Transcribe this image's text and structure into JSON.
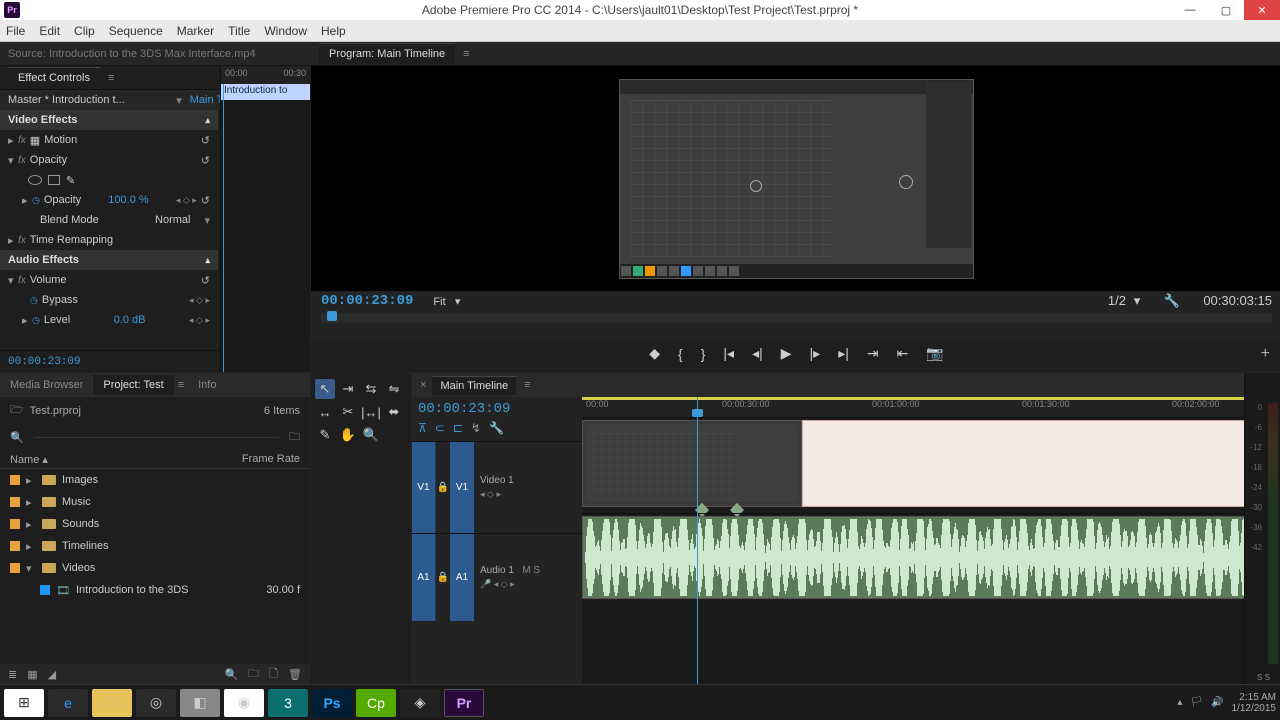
{
  "titlebar": {
    "app_icon_text": "Pr",
    "title": "Adobe Premiere Pro CC 2014 - C:\\Users\\jault01\\Desktop\\Test Project\\Test.prproj *"
  },
  "menubar": [
    "File",
    "Edit",
    "Clip",
    "Sequence",
    "Marker",
    "Title",
    "Window",
    "Help"
  ],
  "source_panel": {
    "tab_label": "Source: Introduction to the 3DS Max Interface.mp4",
    "effect_controls_tab": "Effect Controls",
    "master_label": "Master * Introduction t...",
    "sequence_label": "Main Timeline * Intr...",
    "mini_ruler": [
      "00:00",
      "00:30"
    ],
    "mini_clip": "Introduction to",
    "sections": {
      "video_effects": "Video Effects",
      "motion": "Motion",
      "opacity_group": "Opacity",
      "opacity_param": "Opacity",
      "opacity_value": "100.0 %",
      "blend_mode": "Blend Mode",
      "blend_value": "Normal",
      "time_remapping": "Time Remapping",
      "audio_effects": "Audio Effects",
      "volume": "Volume",
      "bypass": "Bypass",
      "level": "Level",
      "level_value": "0.0 dB"
    },
    "tc_bottom": "00:00:23:09"
  },
  "program": {
    "tab": "Program: Main Timeline",
    "tc": "00:00:23:09",
    "fit": "Fit",
    "zoom_right": "1/2",
    "duration": "00:30:03:15"
  },
  "project": {
    "tabs": [
      "Media Browser",
      "Project: Test",
      "Info"
    ],
    "file": "Test.prproj",
    "items_count": "6 Items",
    "col_name": "Name",
    "col_framerate": "Frame Rate",
    "folders": [
      "Images",
      "Music",
      "Sounds",
      "Timelines",
      "Videos"
    ],
    "clip": {
      "name": "Introduction to the 3DS",
      "rate": "30.00 f"
    }
  },
  "tools": [
    "selection",
    "track-select",
    "ripple",
    "rolling",
    "rate",
    "razor",
    "slip",
    "slide",
    "pen",
    "hand",
    "zoom"
  ],
  "timeline": {
    "tab": "Main Timeline",
    "tc": "00:00:23:09",
    "ruler": [
      "00:00",
      "00:00:30:00",
      "00:01:00:00",
      "00:01:30:00",
      "00:02:00:00"
    ],
    "v1": "V1",
    "a1": "A1",
    "video_label": "Video 1",
    "audio_label": "Audio 1",
    "audio_flags": "M  S"
  },
  "meters_scale": [
    "0",
    "-6",
    "-12",
    "-18",
    "-24",
    "-30",
    "-36",
    "-42"
  ],
  "meters_bottom": "S   S",
  "taskbar": {
    "time": "2:15 AM",
    "date": "1/12/2015"
  }
}
